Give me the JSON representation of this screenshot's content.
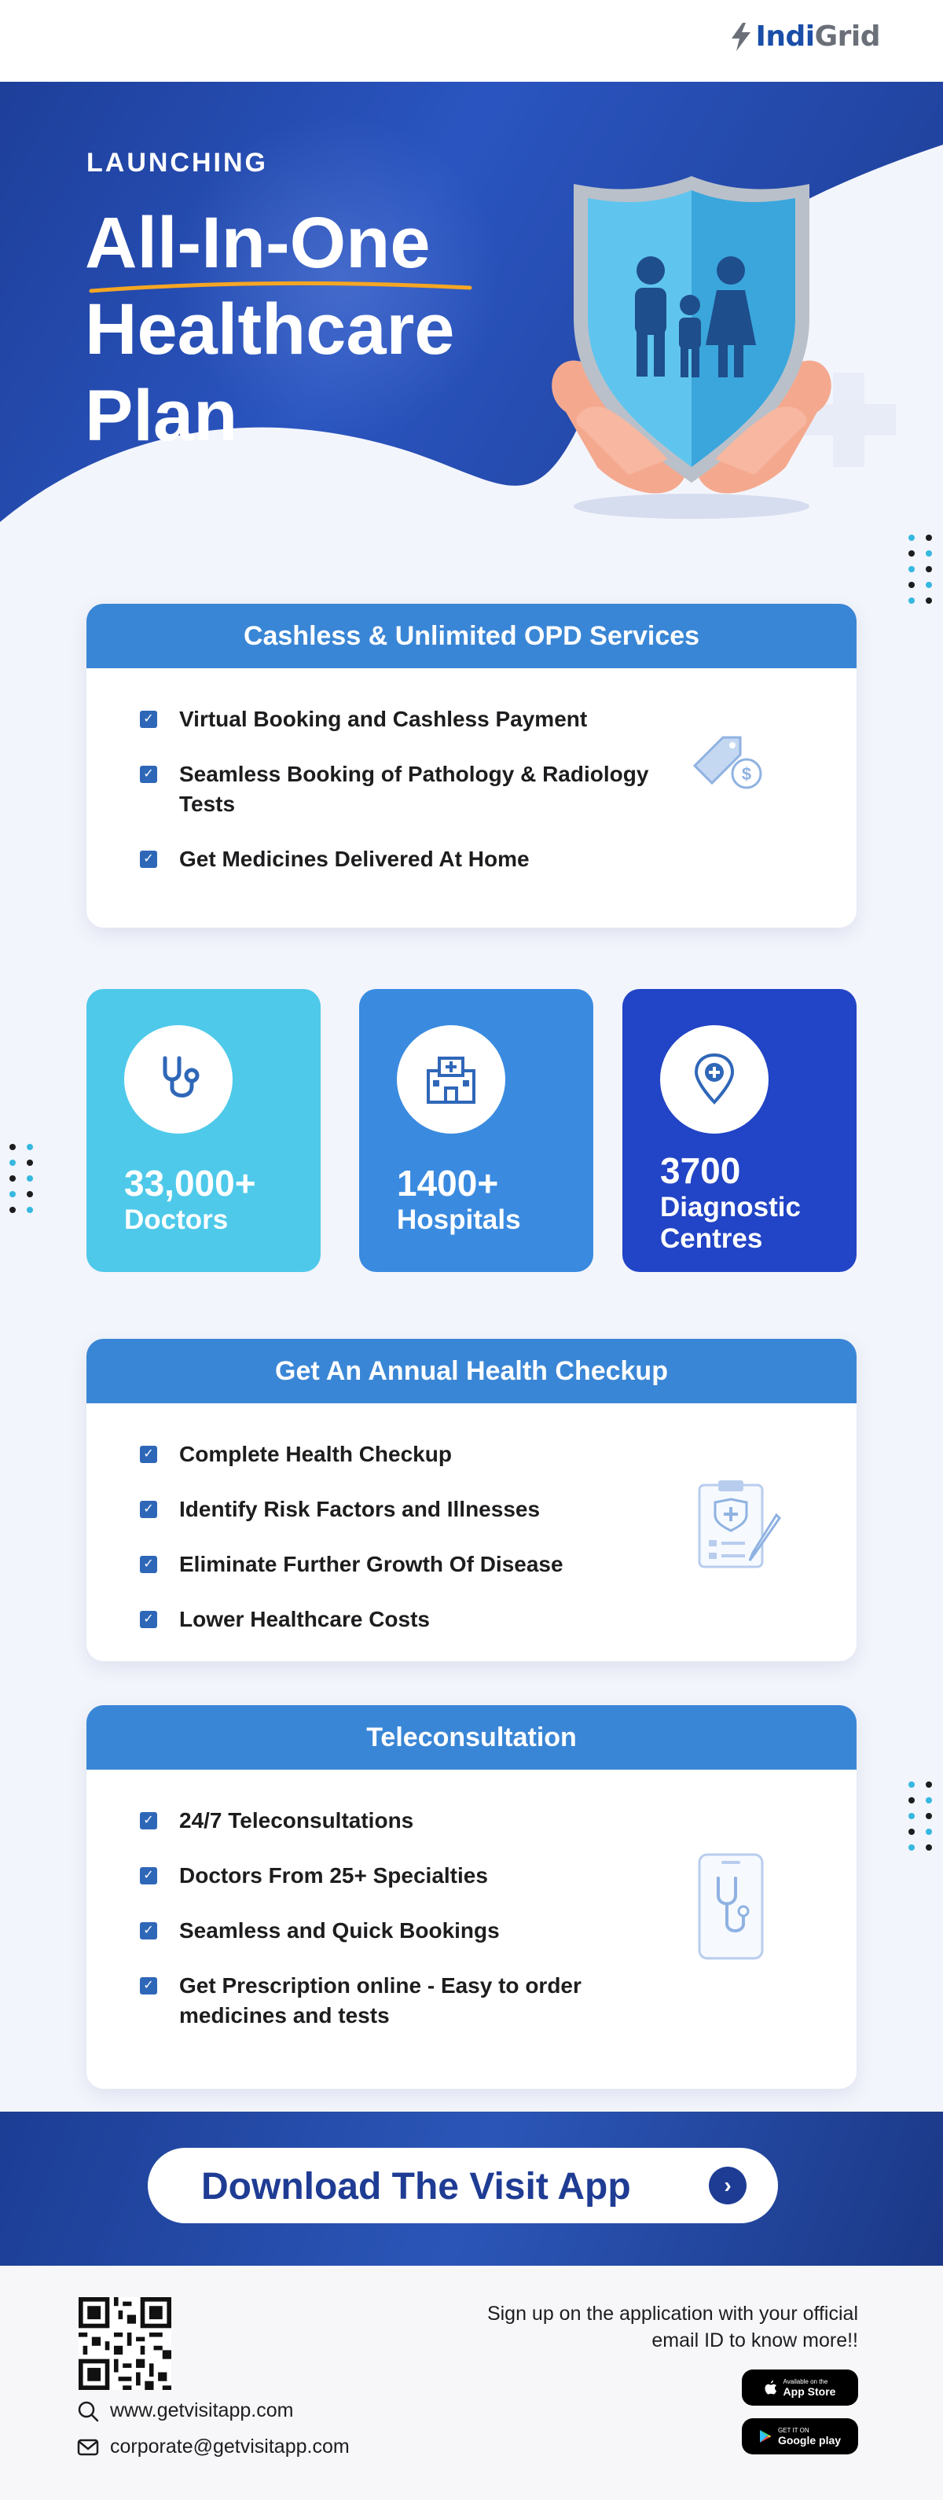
{
  "header": {
    "logo_text_1": "Indi",
    "logo_text_2": "Grid"
  },
  "hero": {
    "eyebrow": "LAUNCHING",
    "title_line1": "All-In-One",
    "title_line2": "Healthcare",
    "title_line3": "Plan"
  },
  "opd": {
    "title": "Cashless & Unlimited OPD Services",
    "items": [
      "Virtual Booking and Cashless Payment",
      "Seamless Booking of Pathology & Radiology Tests",
      "Get Medicines Delivered At Home"
    ]
  },
  "stats": [
    {
      "number": "33,000+",
      "label": "Doctors",
      "icon": "stethoscope-icon",
      "color": "#4ec9ea"
    },
    {
      "number": "1400+",
      "label": "Hospitals",
      "icon": "hospital-icon",
      "color": "#3a8be0"
    },
    {
      "number": "3700",
      "label": "Diagnostic Centres",
      "icon": "location-pin-icon",
      "color": "#2244c6"
    }
  ],
  "checkup": {
    "title": "Get An Annual Health Checkup",
    "items": [
      "Complete Health Checkup",
      "Identify Risk Factors and Illnesses",
      "Eliminate Further Growth Of Disease",
      "Lower Healthcare Costs"
    ]
  },
  "tele": {
    "title": "Teleconsultation",
    "items": [
      "24/7 Teleconsultations",
      "Doctors From 25+ Specialties",
      "Seamless and Quick Bookings",
      "Get Prescription online - Easy to order medicines and tests"
    ]
  },
  "download": {
    "label": "Download The Visit App"
  },
  "footer": {
    "signup_text": "Sign up on the application with your official email ID to know more!!",
    "website": "www.getvisitapp.com",
    "email": "corporate@getvisitapp.com",
    "appstore_small": "Available on the",
    "appstore_big": "App Store",
    "googleplay_small": "GET IT ON",
    "googleplay_big": "Google play"
  },
  "colors": {
    "primary": "#1f3c94",
    "card_header": "#3a86d6",
    "accent_underline": "#f5a623",
    "dot_cyan": "#36b8e0",
    "dot_dark": "#1d1d1f"
  }
}
